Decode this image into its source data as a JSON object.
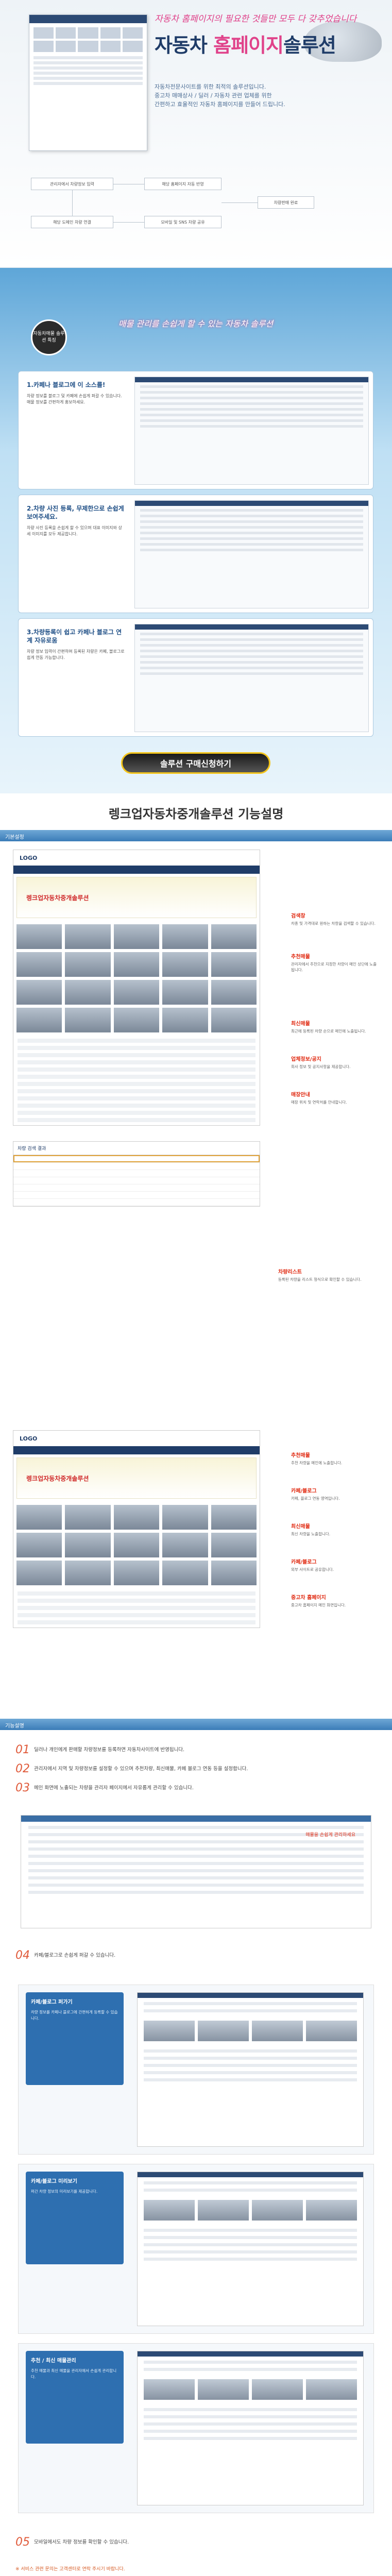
{
  "hero": {
    "tagline": "자동차 홈페이지의 필요한 것들만 모두 다 갖추었습니다",
    "title_a": "자동차 ",
    "title_b": "홈페이지",
    "title_c": "솔루션",
    "desc": [
      "자동차전문사이트를 위한 최적의 솔루션입니다.",
      "중고차 매매상사 / 딜러 / 자동차 관련 업체를 위한",
      "간편하고 효율적인 자동차 홈페이지를 만들어 드립니다."
    ],
    "flow": {
      "box1": "관리자에서 차량정보 입력",
      "box2": "해당 홈페이지 자동 반영",
      "box3": "해당 도메인 차량 연결",
      "box4": "모바일 및 SNS 차량 공유",
      "box5": "차량판매 완료"
    }
  },
  "features": {
    "banner": "매물 관리를 손쉽게 할 수 있는 자동차 솔루션",
    "badge": "자동차매물 솔루션 특징",
    "cards": [
      {
        "title": "1.카페나 블로그에 이 소스를!",
        "desc": "차량 정보를 블로그 및 카페에 손쉽게 퍼갈 수 있습니다. 매물 정보를 간편하게 홍보하세요."
      },
      {
        "title": "2.차량 사진 등록, 무제한으로 손쉽게 보여주세요.",
        "desc": "차량 사진 등록을 손쉽게 할 수 있으며 대표 이미지와 상세 이미지를 모두 제공합니다."
      },
      {
        "title": "3.차량등록이 쉽고 카페나 블로그 연계 자유로움",
        "desc": "차량 정보 입력이 간편하며 등록된 차량은 카페, 블로그로 쉽게 연동 가능합니다."
      }
    ],
    "buy_button": "솔루션 구매신청하기"
  },
  "section1": {
    "title": "렝크업자동차중개솔루션 기능설명",
    "tab": "기본설정",
    "banner": "렝크업자동차중개솔루션",
    "side": [
      {
        "title": "검색창",
        "desc": "차종 및 가격대로 원하는 차량을 검색할 수 있습니다."
      },
      {
        "title": "추천매물",
        "desc": "관리자에서 추천으로 지정한 차량이 메인 상단에 노출됩니다."
      },
      {
        "title": "최신매물",
        "desc": "최근에 등록된 차량 순으로 메인에 노출됩니다."
      },
      {
        "title": "업체정보/공지",
        "desc": "회사 정보 및 공지사항을 제공합니다."
      },
      {
        "title": "매장안내",
        "desc": "매장 위치 및 연락처를 안내합니다."
      }
    ],
    "table_title": "차량 검색 결과",
    "side2": [
      {
        "title": "차량리스트",
        "desc": "등록된 차량을 리스트 형식으로 확인할 수 있습니다."
      }
    ]
  },
  "section2": {
    "side": [
      {
        "title": "추천매물",
        "desc": "추천 차량을 메인에 노출합니다."
      },
      {
        "title": "카페/블로그",
        "desc": "카페, 블로그 연동 영역입니다."
      },
      {
        "title": "최신매물",
        "desc": "최신 차량을 노출합니다."
      },
      {
        "title": "카페/블로그",
        "desc": "외부 사이트로 공유합니다."
      },
      {
        "title": "중고차 홈페이지",
        "desc": "중고차 홈페이지 메인 화면입니다."
      }
    ]
  },
  "section3": {
    "tab": "기능설명",
    "steps": [
      {
        "no": "01",
        "text": "딜러나 개인에게 판매할 차량정보를 등록하면 자동차사이트에 반영됩니다."
      },
      {
        "no": "02",
        "text": "관리자에서 지역 및 차량정보를 설정할 수 있으며 추천차량, 최신매물, 카페 블로그 연동 등을 설정합니다."
      },
      {
        "no": "03",
        "text": "메인 화면에 노출되는 차량을 관리자 페이지에서 자유롭게 관리할 수 있습니다."
      },
      {
        "no": "04",
        "text": "카페/블로그로 손쉽게 퍼갈 수 있습니다."
      }
    ],
    "callout": "매물을 손쉽게 관리하세요",
    "panels": [
      {
        "title": "카페/블로그 퍼가기",
        "desc": "차량 정보를 카페나 블로그에 간편하게 등록할 수 있습니다."
      },
      {
        "title": "카페/블로그 미리보기",
        "desc": "퍼간 차량 정보의 미리보기를 제공합니다."
      },
      {
        "title": "추천 / 최신 매물관리",
        "desc": "추천 매물과 최신 매물을 관리자에서 손쉽게 관리합니다."
      }
    ],
    "step5": {
      "no": "05",
      "text": "모바일에서도 차량 정보를 확인할 수 있습니다."
    },
    "note": "※ 서비스 관련 문의는 고객센터로 연락 주시기 바랍니다."
  }
}
